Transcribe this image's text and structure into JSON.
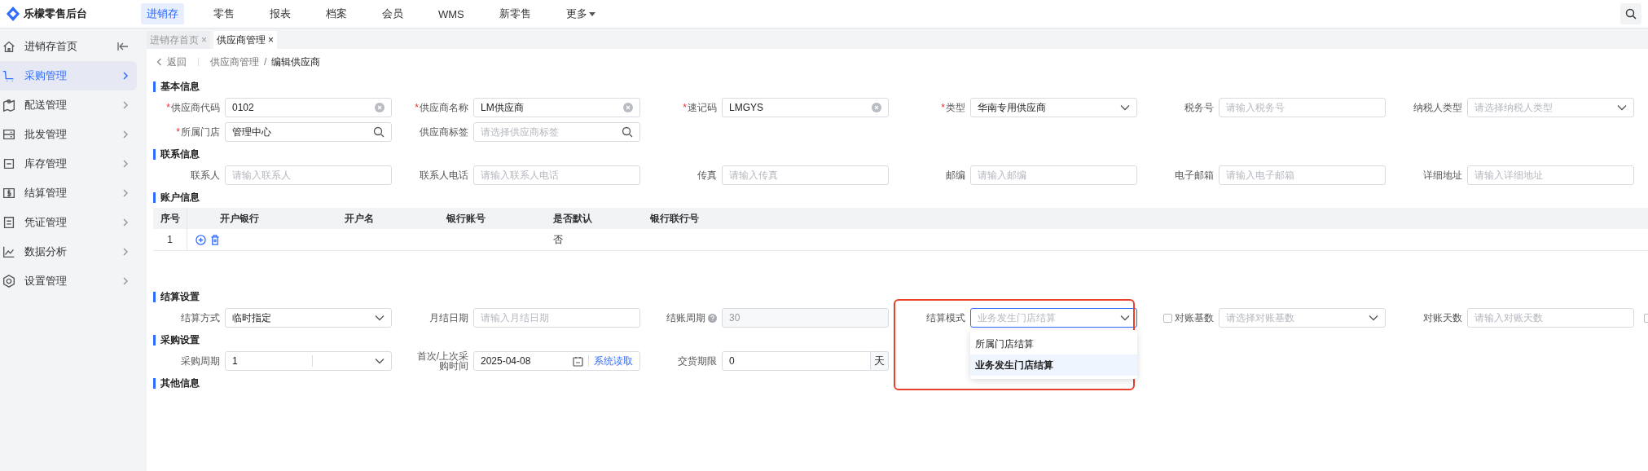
{
  "app": {
    "title": "乐檬零售后台"
  },
  "nav": [
    {
      "label": "进销存",
      "selected": true
    },
    {
      "label": "零售",
      "selected": false
    },
    {
      "label": "报表",
      "selected": false
    },
    {
      "label": "档案",
      "selected": false
    },
    {
      "label": "会员",
      "selected": false
    },
    {
      "label": "WMS",
      "selected": false
    },
    {
      "label": "新零售",
      "selected": false
    },
    {
      "label": "更多",
      "selected": false,
      "menu": true
    }
  ],
  "sidebar": {
    "items": [
      {
        "label": "进销存首页",
        "selected": false,
        "kind": "home"
      },
      {
        "label": "采购管理",
        "selected": true,
        "kind": "group"
      },
      {
        "label": "配送管理",
        "selected": false,
        "kind": "group"
      },
      {
        "label": "批发管理",
        "selected": false,
        "kind": "group"
      },
      {
        "label": "库存管理",
        "selected": false,
        "kind": "group"
      },
      {
        "label": "结算管理",
        "selected": false,
        "kind": "group"
      },
      {
        "label": "凭证管理",
        "selected": false,
        "kind": "group"
      },
      {
        "label": "数据分析",
        "selected": false,
        "kind": "group"
      },
      {
        "label": "设置管理",
        "selected": false,
        "kind": "group"
      }
    ]
  },
  "tabs": [
    {
      "label": "进销存首页",
      "close": "×",
      "selected": false
    },
    {
      "label": "供应商管理",
      "close": "×",
      "selected": true
    }
  ],
  "breadcrumb": {
    "back": "返回",
    "path": [
      "供应商管理",
      "编辑供应商"
    ],
    "separator": "/"
  },
  "sections": [
    {
      "title": "基本信息",
      "rows": [
        [
          {
            "label": "供应商代码",
            "required_mark": "*",
            "kind": "clear",
            "value": "0102"
          },
          {
            "label": "供应商名称",
            "required_mark": "*",
            "kind": "clear",
            "value": "LM供应商"
          },
          {
            "label": "速记码",
            "required_mark": "*",
            "kind": "clear",
            "value": "LMGYS"
          },
          {
            "label": "类型",
            "required_mark": "*",
            "kind": "select",
            "value": "华南专用供应商"
          },
          {
            "label": "税务号",
            "kind": "plain",
            "placeholder": "请输入税务号"
          },
          {
            "label": "纳税人类型",
            "kind": "select",
            "placeholder": "请选择纳税人类型"
          }
        ],
        [
          {
            "label": "所属门店",
            "required_mark": "*",
            "kind": "search",
            "value": "管理中心"
          },
          {
            "label": "供应商标签",
            "kind": "search",
            "placeholder": "请选择供应商标签"
          }
        ]
      ]
    },
    {
      "title": "联系信息",
      "rows": [
        [
          {
            "label": "联系人",
            "kind": "plain",
            "placeholder": "请输入联系人"
          },
          {
            "label": "联系人电话",
            "kind": "plain",
            "placeholder": "请输入联系人电话"
          },
          {
            "label": "传真",
            "kind": "plain",
            "placeholder": "请输入传真"
          },
          {
            "label": "邮编",
            "kind": "plain",
            "placeholder": "请输入邮编"
          },
          {
            "label": "电子邮箱",
            "kind": "plain",
            "placeholder": "请输入电子邮箱"
          },
          {
            "label": "详细地址",
            "kind": "plain",
            "placeholder": "请输入详细地址"
          }
        ]
      ]
    },
    {
      "title": "账户信息",
      "table": {
        "columns": [
          "序号",
          "开户银行",
          "开户名",
          "银行账号",
          "是否默认",
          "银行联行号"
        ],
        "rows": [
          {
            "index": "1",
            "is_default": "否"
          }
        ]
      }
    },
    {
      "title": "结算设置",
      "rows": [
        [
          {
            "label": "结算方式",
            "kind": "select",
            "value": "临时指定"
          },
          {
            "label": "月结日期",
            "kind": "plain",
            "placeholder": "请输入月结日期"
          },
          {
            "label": "结账周期",
            "kind": "plain",
            "value": "30",
            "disabled": true,
            "help": true
          },
          {
            "label": "结算模式",
            "kind": "select",
            "placeholder": "业务发生门店结算",
            "focused": true,
            "highlighted": true,
            "dropdown": [
              {
                "label": "所属门店结算",
                "selected": false
              },
              {
                "label": "业务发生门店结算",
                "selected": true
              }
            ]
          },
          {
            "label": "对账基数",
            "kind": "select",
            "placeholder": "请选择对账基数",
            "checked": false
          },
          {
            "label": "对账天数",
            "kind": "plain",
            "placeholder": "请输入对账天数"
          },
          {
            "kind": "checkbox",
            "checked": false
          }
        ]
      ]
    },
    {
      "title": "采购设置",
      "rows": [
        [
          {
            "label": "采购周期",
            "kind": "split-select",
            "value": "1"
          },
          {
            "label": "首次/上次采购时间",
            "kind": "date",
            "value": "2025-04-08",
            "action": "系统读取"
          },
          {
            "label": "交货期限",
            "kind": "addon",
            "value": "0",
            "addon": "天"
          }
        ]
      ]
    },
    {
      "title": "其他信息"
    }
  ]
}
